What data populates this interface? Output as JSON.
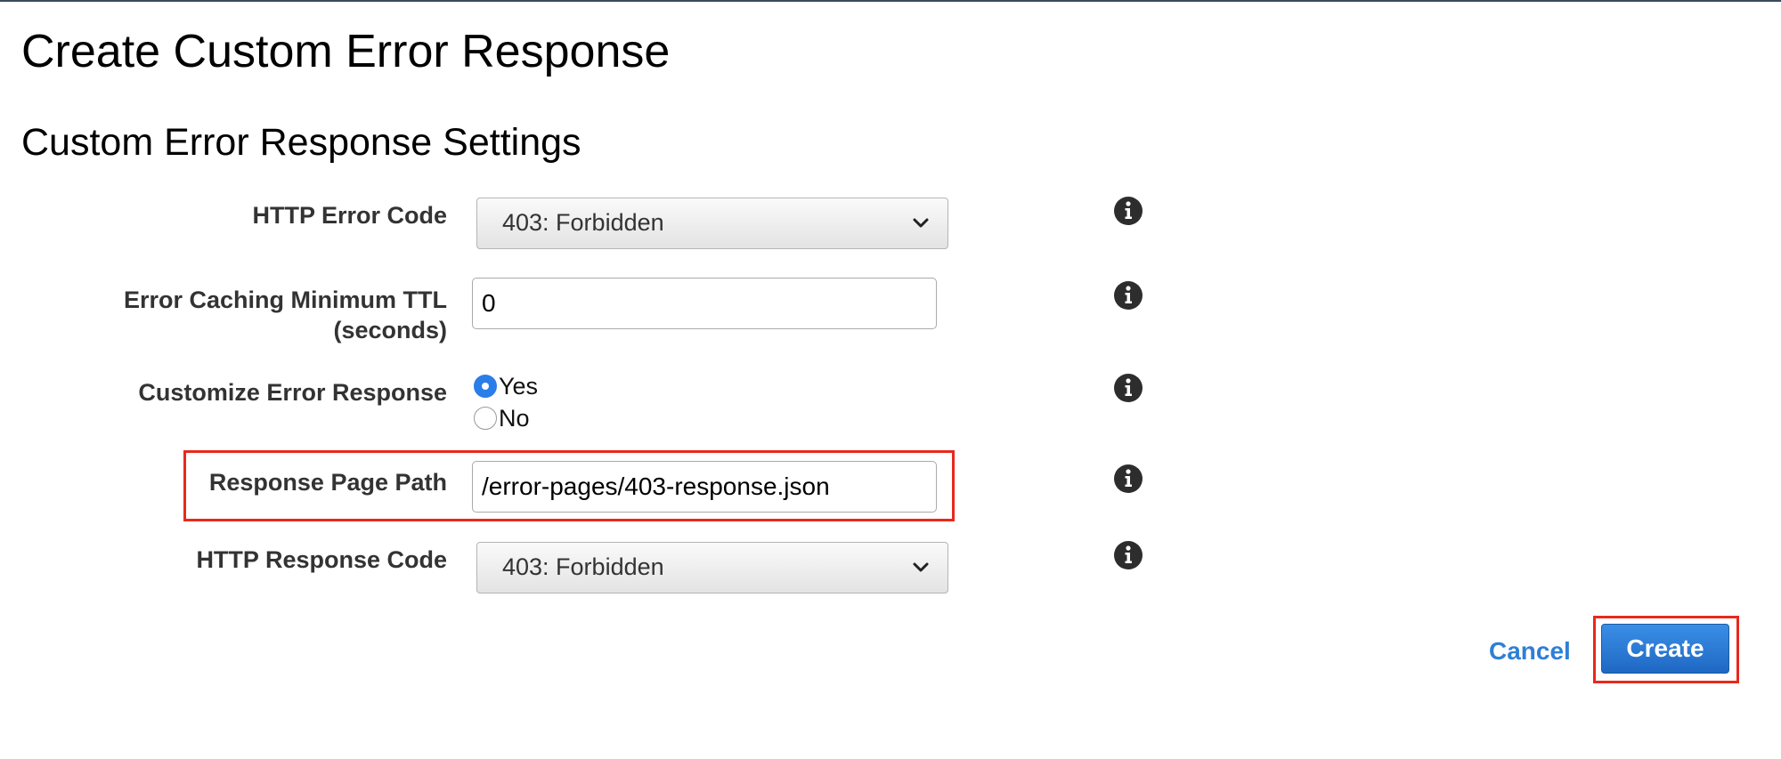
{
  "page": {
    "title": "Create Custom Error Response",
    "section_title": "Custom Error Response Settings"
  },
  "form": {
    "http_error_code": {
      "label": "HTTP Error Code",
      "value": "403: Forbidden"
    },
    "error_caching_ttl": {
      "label_line1": "Error Caching Minimum TTL",
      "label_line2": "(seconds)",
      "value": "0"
    },
    "customize_error_response": {
      "label": "Customize Error Response",
      "options": [
        {
          "label": "Yes",
          "selected": true
        },
        {
          "label": "No",
          "selected": false
        }
      ]
    },
    "response_page_path": {
      "label": "Response Page Path",
      "value": "/error-pages/403-response.json"
    },
    "http_response_code": {
      "label": "HTTP Response Code",
      "value": "403: Forbidden"
    }
  },
  "actions": {
    "cancel_label": "Cancel",
    "create_label": "Create"
  },
  "icons": {
    "info": "info-icon",
    "dropdown": "chevron-down-icon"
  },
  "colors": {
    "highlight": "#e8291c",
    "primary_button": "#1f68c4",
    "link": "#2f7fd6",
    "radio_selected": "#2b7de9"
  }
}
